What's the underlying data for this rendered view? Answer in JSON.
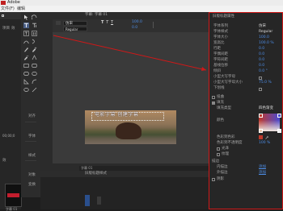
{
  "app": {
    "title": "Adobe",
    "menu": "文件(F)",
    "menu_edit": "编辑"
  },
  "left_panel": {
    "tab": "项目",
    "tab2": "效",
    "timecode": "00;00;0",
    "sections": [
      "对齐",
      "字体",
      "样式",
      "对象",
      "变换"
    ],
    "thumb_name": "字幕 01",
    "thumb_caption": "字幕 01"
  },
  "monitor": {
    "tab": "字幕: 字幕 01",
    "font_family": "仿宋",
    "font_style": "Regular",
    "font_size": "100.0",
    "leading": "0.0",
    "subtitle": "字幕 01",
    "title_text": "电影字幕 创建字幕",
    "style_panel_title": "旧版标题样式"
  },
  "properties": {
    "title": "旧版标题属性",
    "rows": [
      {
        "label": "字体系列",
        "value": "仿宋"
      },
      {
        "label": "字体样式",
        "value": "Regular"
      },
      {
        "label": "字体大小",
        "value": "100.0"
      },
      {
        "label": "宽高比",
        "value": "100.0 %"
      },
      {
        "label": "行距",
        "value": "0.0"
      },
      {
        "label": "字偶间距",
        "value": "0.0"
      },
      {
        "label": "字符间距",
        "value": "0.0"
      },
      {
        "label": "基线位移",
        "value": "0.0"
      },
      {
        "label": "倾斜",
        "value": "0.0 °"
      },
      {
        "label": "小型大写字母",
        "value": ""
      },
      {
        "label": "小型大写字母大小",
        "value": "75.0 %"
      },
      {
        "label": "下划线",
        "value": ""
      }
    ],
    "distort": "扭曲",
    "fill_header": "填充",
    "fill_type_label": "填充类型",
    "fill_type_value": "四色渐变",
    "color_label": "颜色",
    "color_stop_label": "色彩到色彩",
    "color_stop_opacity": "色彩到不透明度",
    "opacity_value": "100 %",
    "sheen": "光泽",
    "texture": "纹理",
    "stroke_header": "描边",
    "inner_stroke": "内描边",
    "inner_add": "添加",
    "outer_stroke": "外描边",
    "outer_add": "添加",
    "shadow": "阴影",
    "colors": {
      "tl": "#c0392b",
      "tr": "#4a4ad0",
      "bl": "#e8c8b0",
      "br": "#f0f0f0",
      "accent": "#4d8de6",
      "highlight_box": "#d01818"
    }
  }
}
